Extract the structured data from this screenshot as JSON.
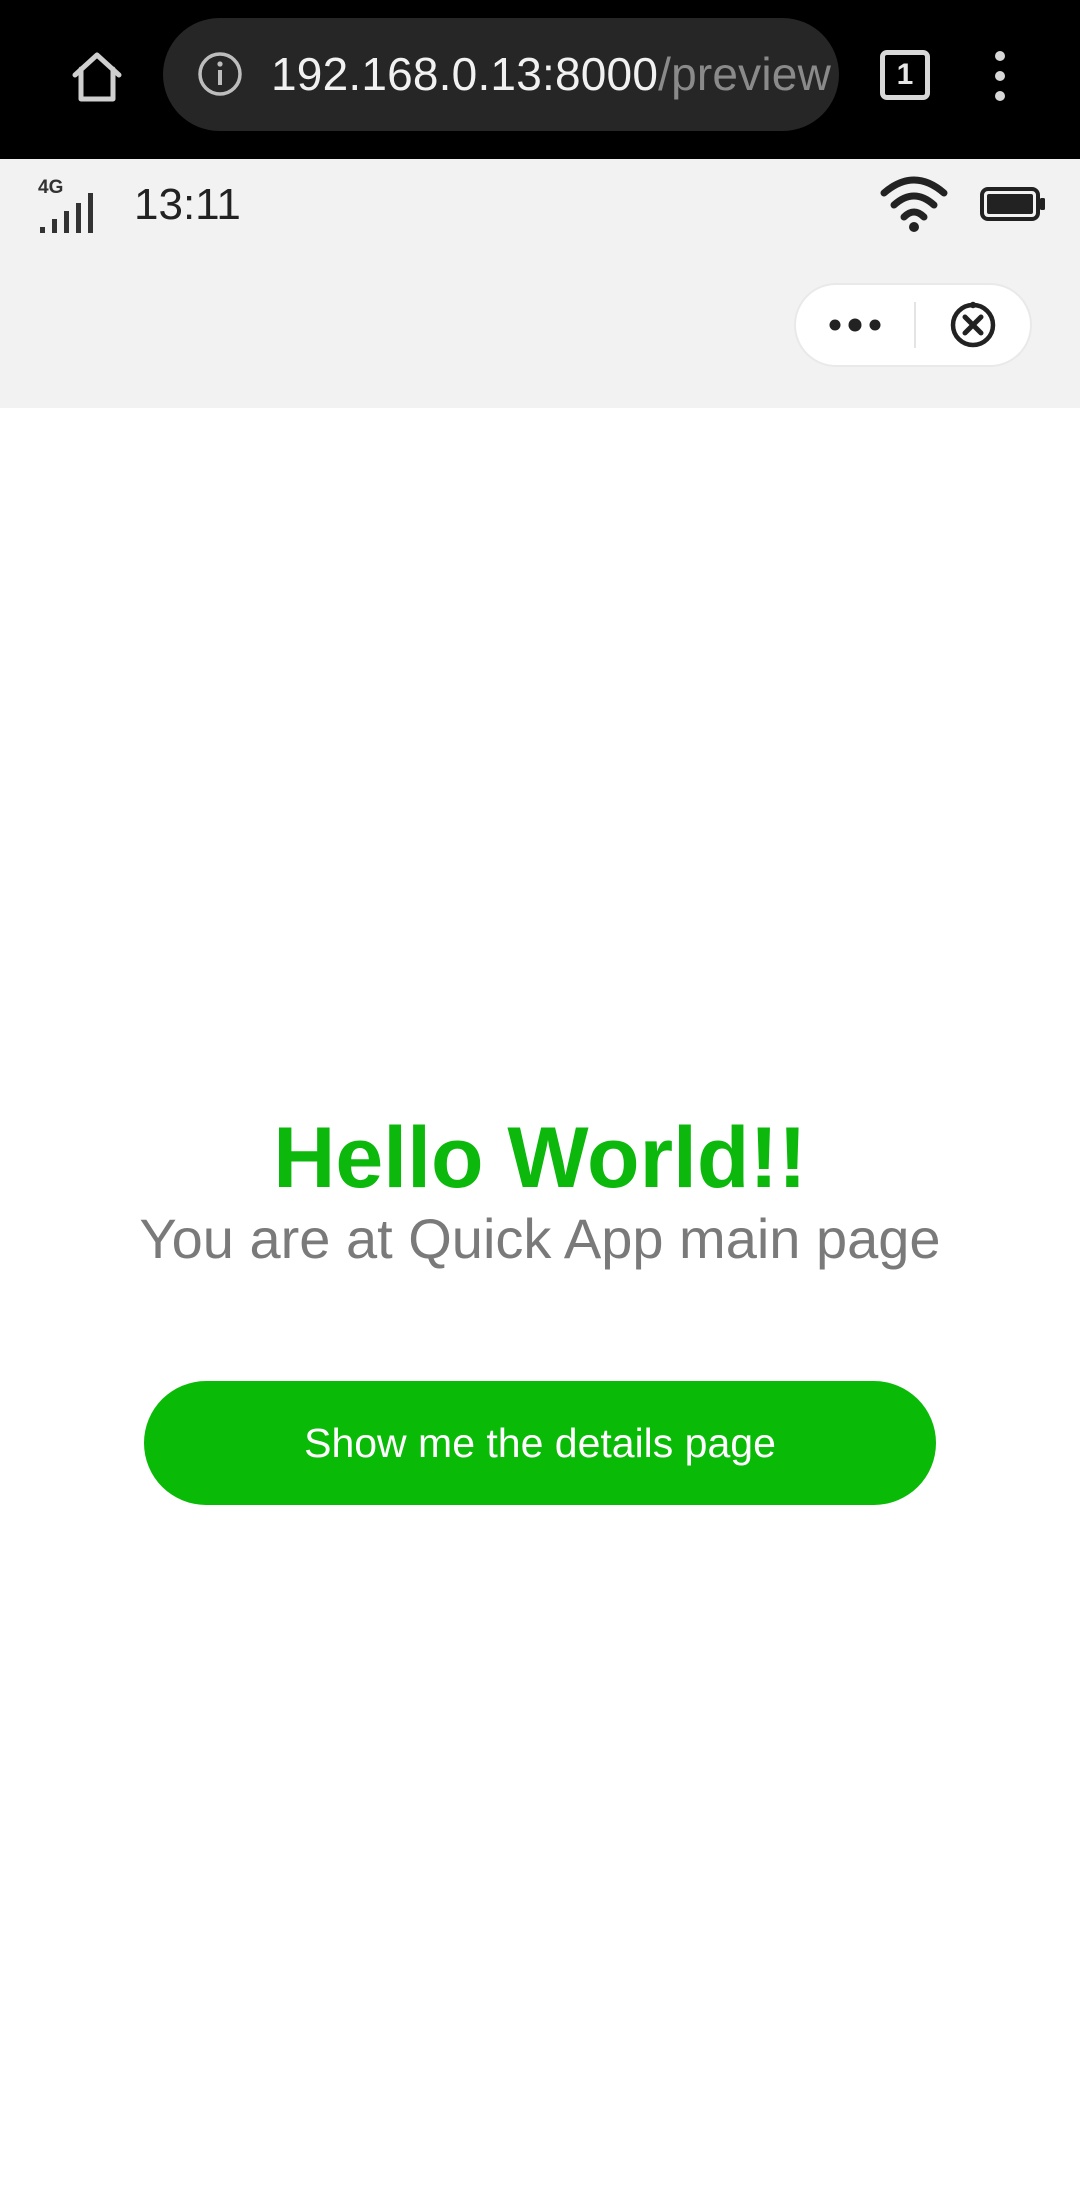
{
  "browser": {
    "url_host": "192.168.0.13:8000",
    "url_path": "/preview",
    "tab_count": "1",
    "icons": {
      "home": "home-icon",
      "info": "info-icon",
      "menu": "more-vertical-icon"
    },
    "colors": {
      "bar_background": "#000000",
      "url_background": "#262626"
    }
  },
  "status_bar": {
    "network_type": "4G",
    "time": "13:11",
    "icons": {
      "signal": "signal-icon",
      "wifi": "wifi-icon",
      "battery": "battery-icon"
    }
  },
  "header": {
    "capsule_icons": {
      "more": "more-horizontal-icon",
      "close": "close-circle-icon"
    }
  },
  "main": {
    "title": "Hello World!!",
    "subtitle": "You are at Quick App main page",
    "button_label": "Show me the details page",
    "colors": {
      "accent": "#09bb07",
      "title": "#0cb80c",
      "subtitle": "#7a7a7a"
    }
  }
}
